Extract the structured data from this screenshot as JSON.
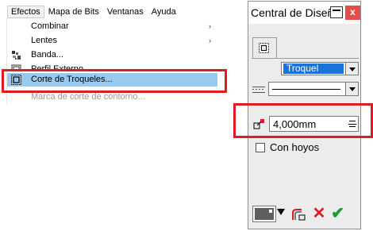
{
  "menubar": {
    "items": [
      {
        "label": "Efectos"
      },
      {
        "label": "Mapa de Bits"
      },
      {
        "label": "Ventanas"
      },
      {
        "label": "Ayuda"
      }
    ]
  },
  "menu": {
    "items": [
      {
        "label": "Combinar",
        "submenu": true
      },
      {
        "label": "Lentes",
        "submenu": true
      },
      {
        "label": "Banda...",
        "icon": "blend-icon"
      },
      {
        "label": "Perfil Externo",
        "icon": "contour-icon"
      },
      {
        "label": "Corte de Troqueles...",
        "icon": "die-cut-icon",
        "selected": true
      },
      {
        "label": "Marca de corte de contorno...",
        "disabled": true
      }
    ],
    "submenu_arrow": "›"
  },
  "panel": {
    "title": "Central de Diseño",
    "close_glyph": "x",
    "type_select": "Troquel",
    "offset_value": "4,000mm",
    "holes_label": "Con hoyos",
    "delete_glyph": "✕",
    "apply_glyph": "✔"
  },
  "colors": {
    "highlight": "#e11b22",
    "selection": "#99c9ef",
    "dropdown_selected": "#1a73d9"
  }
}
